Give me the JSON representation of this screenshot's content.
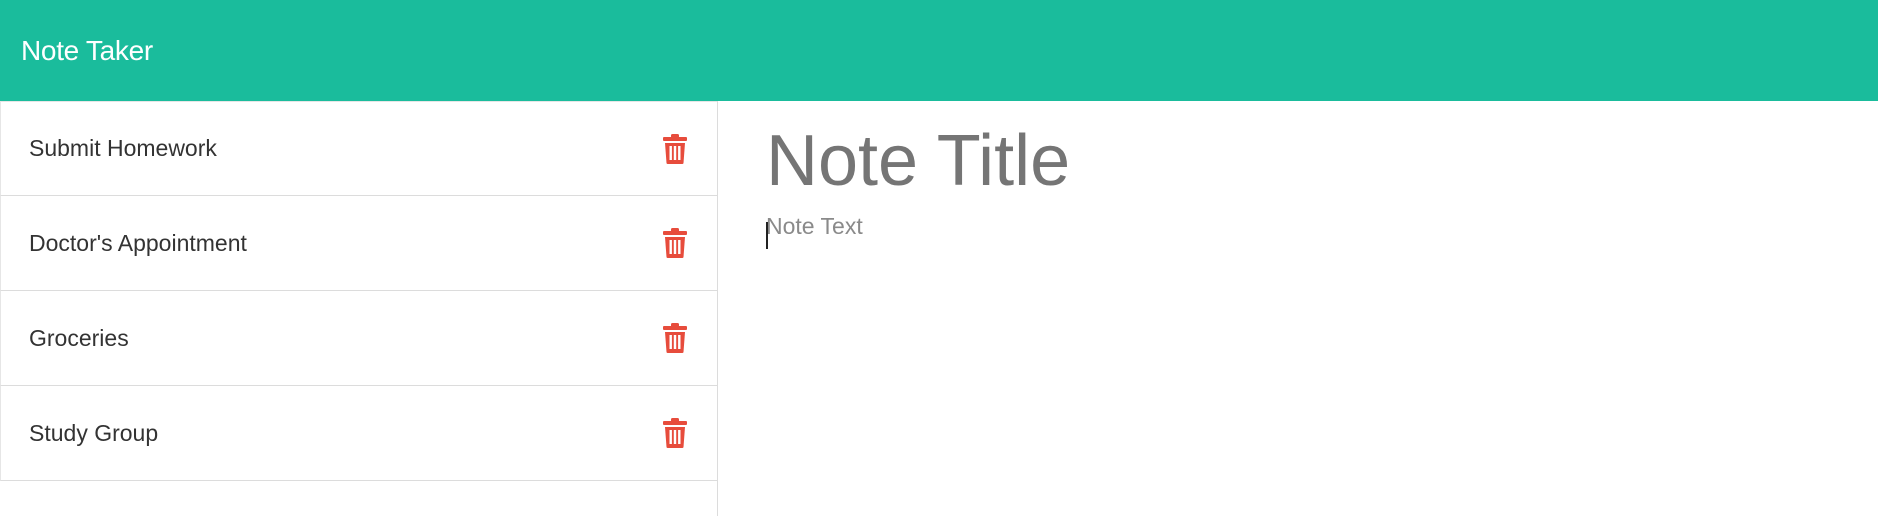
{
  "app": {
    "title": "Note Taker",
    "accent_color": "#1abc9c",
    "delete_color": "#e74c3c"
  },
  "notes": {
    "items": [
      {
        "label": "Submit Homework",
        "icon": "trash-icon"
      },
      {
        "label": "Doctor's Appointment",
        "icon": "trash-icon"
      },
      {
        "label": "Groceries",
        "icon": "trash-icon"
      },
      {
        "label": "Study Group",
        "icon": "trash-icon"
      }
    ]
  },
  "editor": {
    "title_placeholder": "Note Title",
    "text_placeholder": "Note Text"
  }
}
